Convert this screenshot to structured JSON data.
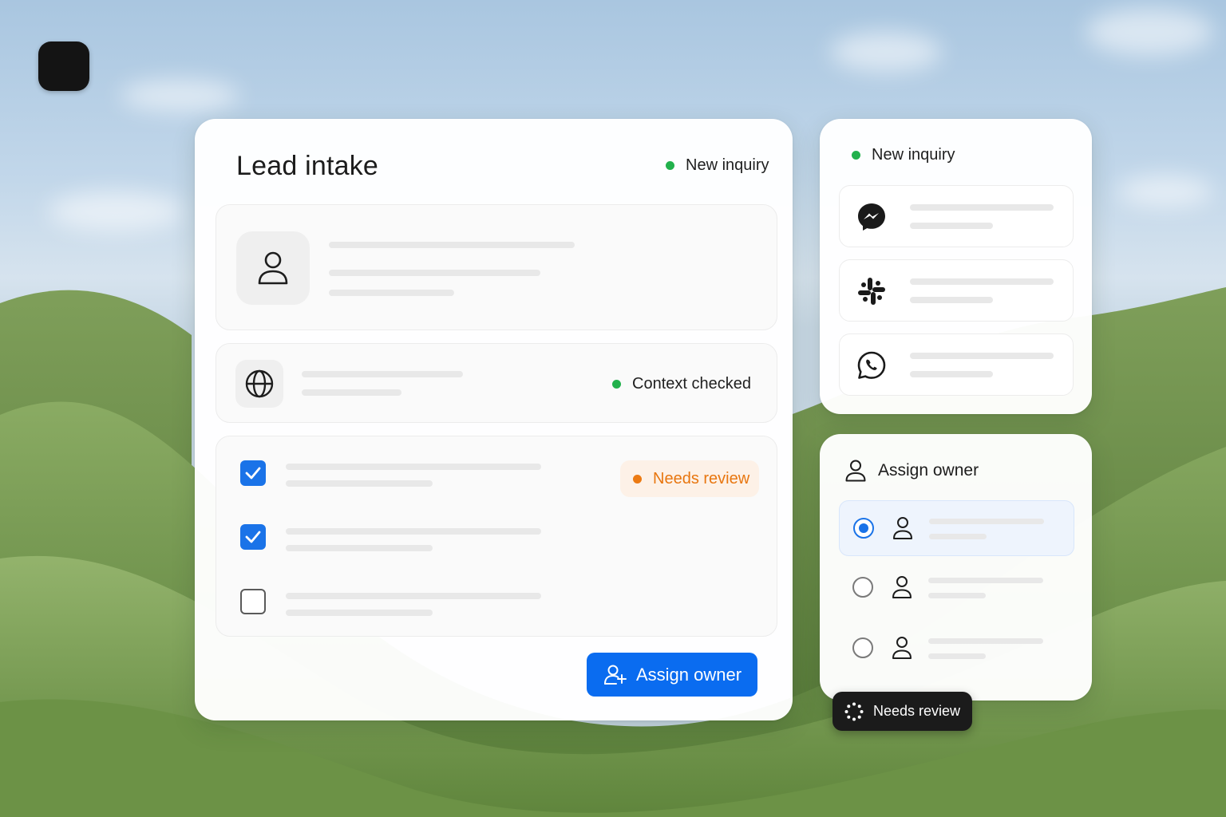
{
  "lead_card": {
    "title": "Lead intake",
    "status_label": "New inquiry",
    "context_status": "Context checked",
    "review_badge": "Needs review",
    "tasks": [
      {
        "checked": true
      },
      {
        "checked": true
      },
      {
        "checked": false
      }
    ],
    "assign_button_label": "Assign owner"
  },
  "inquiry_card": {
    "status_label": "New inquiry",
    "channels": [
      {
        "icon": "messenger-icon"
      },
      {
        "icon": "slack-icon"
      },
      {
        "icon": "whatsapp-icon"
      }
    ]
  },
  "assign_card": {
    "title": "Assign owner",
    "options": [
      {
        "selected": true
      },
      {
        "selected": false
      },
      {
        "selected": false
      }
    ]
  },
  "toast": {
    "label": "Needs review"
  },
  "colors": {
    "accent": "#0a6cf0",
    "status_green": "#22b14c",
    "review_orange": "#ec7a12",
    "review_bg": "#fdf1e7"
  }
}
